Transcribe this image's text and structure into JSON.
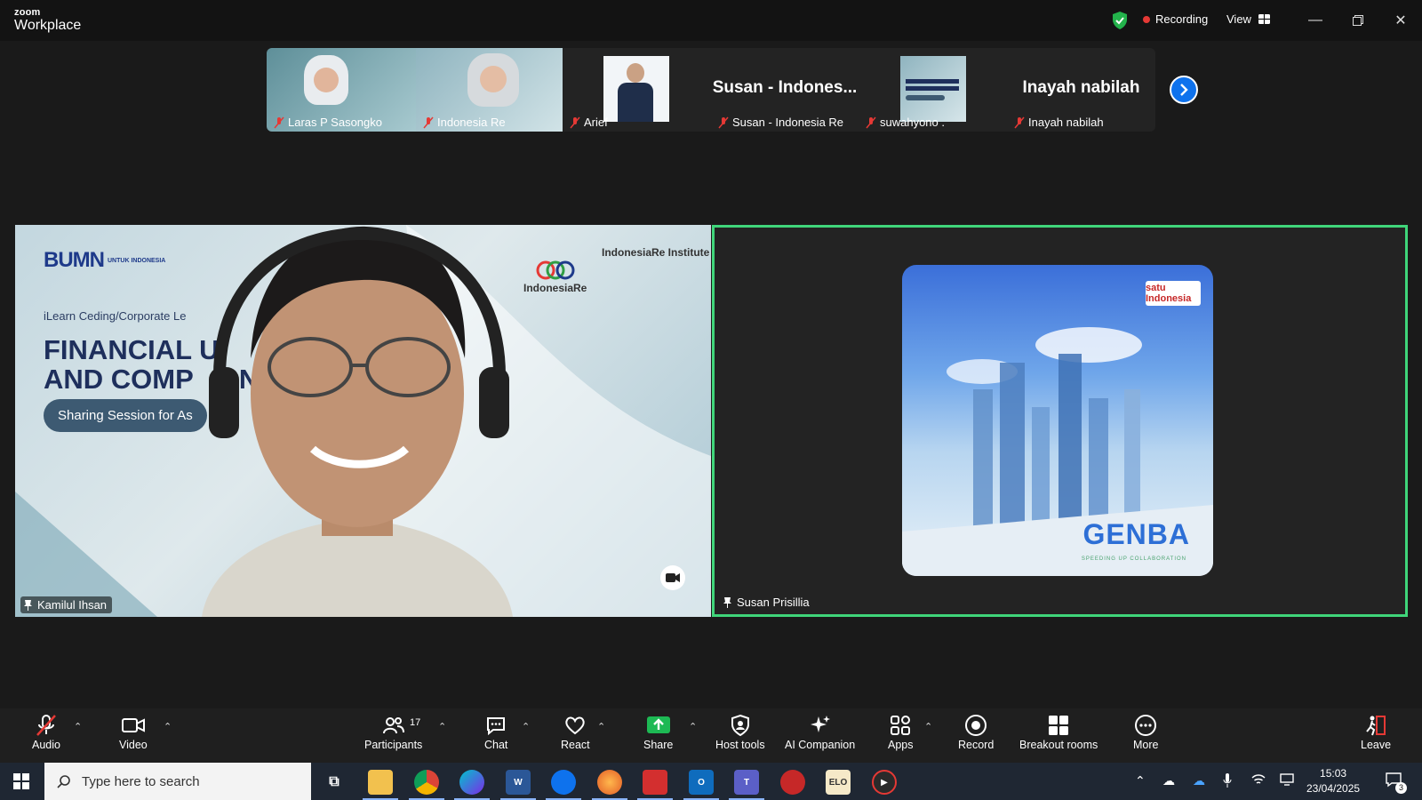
{
  "titlebar": {
    "logo_line1": "zoom",
    "logo_line2": "Workplace",
    "recording_label": "Recording",
    "view_label": "View"
  },
  "filmstrip": {
    "tiles": [
      {
        "name": "Laras P Sasongko",
        "muted": true
      },
      {
        "name": "Indonesia Re",
        "muted": true
      },
      {
        "name": "Arief",
        "muted": true
      },
      {
        "name": "Susan - Indonesia Re",
        "big_label": "Susan - Indones...",
        "muted": true
      },
      {
        "name": "suwahyono .",
        "muted": true
      },
      {
        "name": "Inayah nabilah",
        "big_label": "Inayah nabilah",
        "muted": true
      }
    ]
  },
  "main": {
    "left": {
      "name": "Kamilul Ihsan",
      "slide": {
        "bumn": "BUMN",
        "bumn_small": "UNTUK INDONESIA",
        "brand1": "IndonesiaRe",
        "brand2": "IndonesiaRe Institute",
        "subtitle": "iLearn Ceding/Corporate Le",
        "title_line1": "FINANCIAL U",
        "title_line2": "AND COMP      NCE",
        "pill": "Sharing Session for As"
      }
    },
    "right": {
      "name": "Susan Prisillia",
      "genba_word": "GENBA",
      "genba_tag": "SPEEDING UP COLLABORATION",
      "satu": "satu Indonesia"
    }
  },
  "toolbar": {
    "audio": "Audio",
    "video": "Video",
    "participants": "Participants",
    "participants_count": "17",
    "chat": "Chat",
    "react": "React",
    "share": "Share",
    "host_tools": "Host tools",
    "ai_companion": "AI Companion",
    "apps": "Apps",
    "record": "Record",
    "breakout": "Breakout rooms",
    "more": "More",
    "leave": "Leave"
  },
  "taskbar": {
    "search_placeholder": "Type here to search",
    "time": "15:03",
    "date": "23/04/2025",
    "notif_count": "3"
  },
  "colors": {
    "active_speaker": "#3fd57a",
    "share_green": "#1db954",
    "zoom_blue": "#0e72ed",
    "leave_red": "#e53935"
  }
}
